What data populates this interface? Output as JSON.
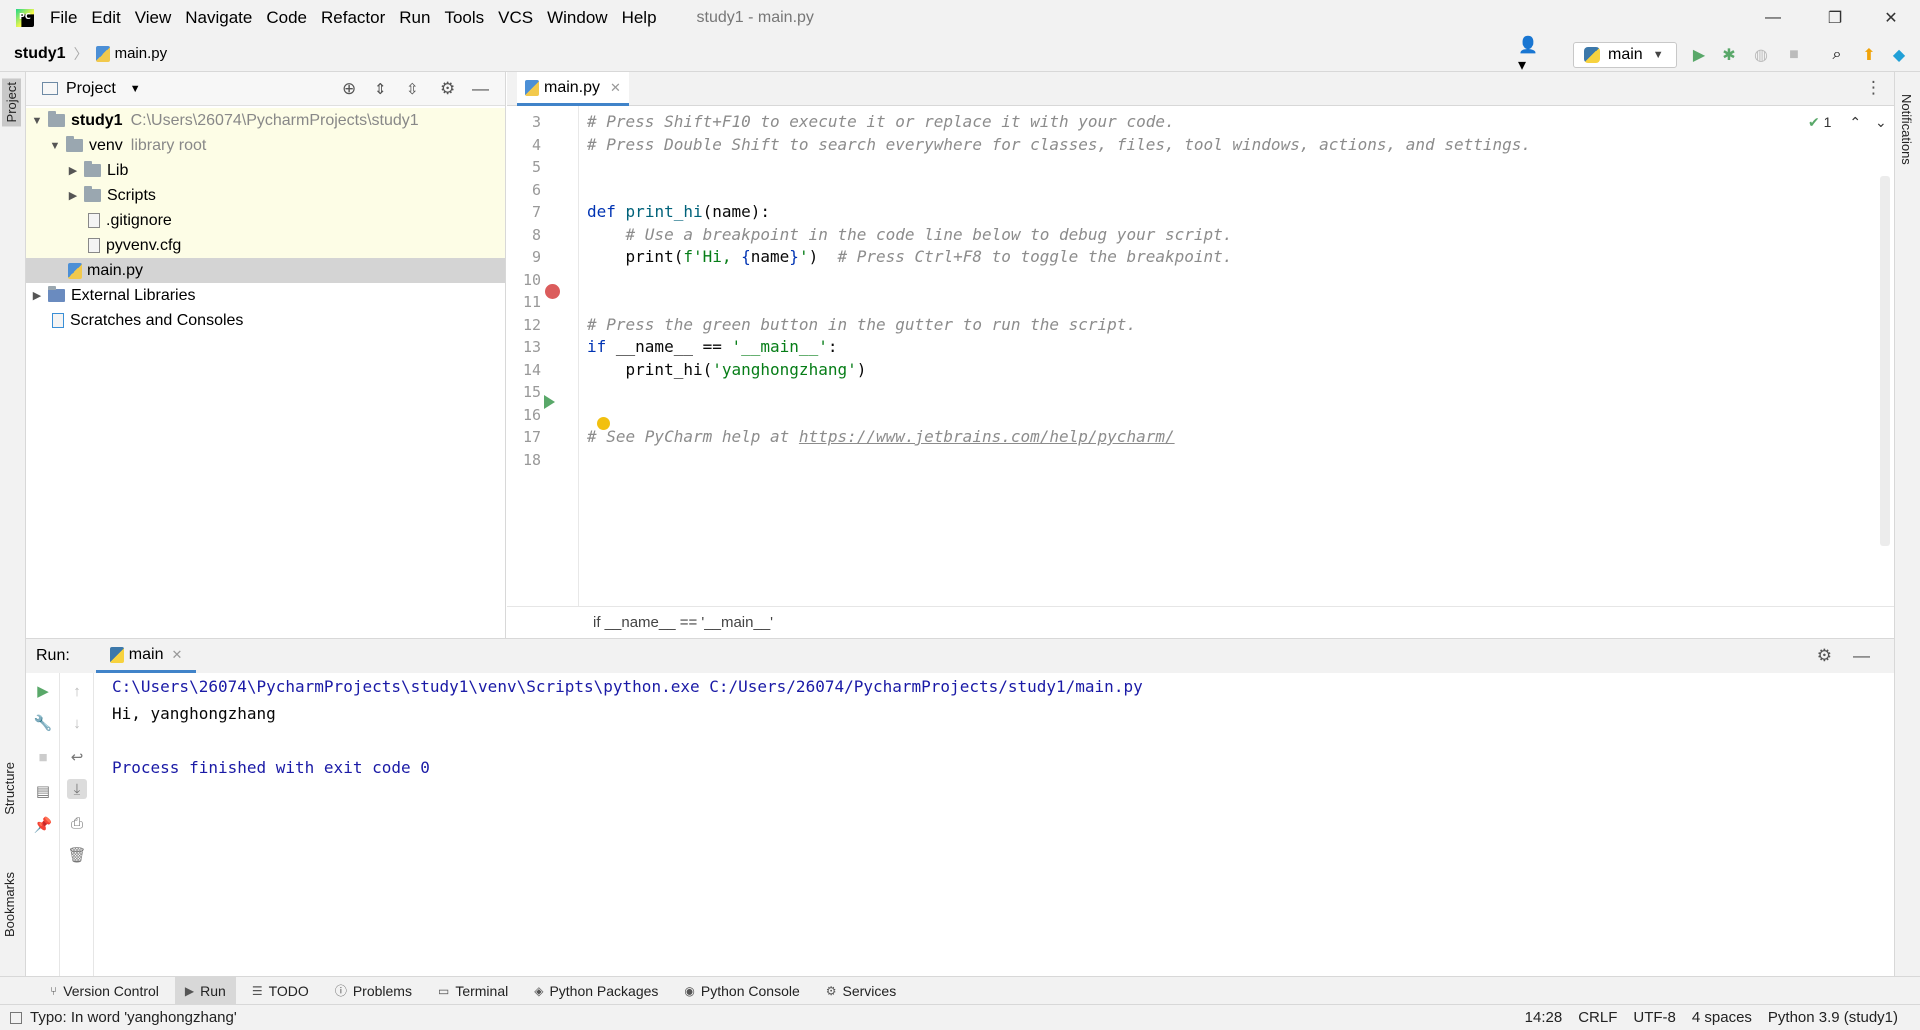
{
  "menu": [
    "File",
    "Edit",
    "View",
    "Navigate",
    "Code",
    "Refactor",
    "Run",
    "Tools",
    "VCS",
    "Window",
    "Help"
  ],
  "window_title": "study1 - main.py",
  "navbar": {
    "root": "study1",
    "file": "main.py"
  },
  "run_config": "main",
  "left_tabs": {
    "project": "Project",
    "structure": "Structure",
    "bookmarks": "Bookmarks"
  },
  "right_tabs": {
    "notifications": "Notifications"
  },
  "project": {
    "header": "Project",
    "tree": [
      {
        "label": "study1",
        "hint": "C:\\Users\\26074\\PycharmProjects\\study1",
        "level": 0,
        "arrow": "▼",
        "icon": "folder"
      },
      {
        "label": "venv",
        "hint": "library root",
        "level": 1,
        "arrow": "▼",
        "icon": "folder"
      },
      {
        "label": "Lib",
        "hint": "",
        "level": 2,
        "arrow": "▶",
        "icon": "folder"
      },
      {
        "label": "Scripts",
        "hint": "",
        "level": 2,
        "arrow": "▶",
        "icon": "folder"
      },
      {
        "label": ".gitignore",
        "hint": "",
        "level": 2,
        "arrow": "",
        "icon": "doc"
      },
      {
        "label": "pyvenv.cfg",
        "hint": "",
        "level": 2,
        "arrow": "",
        "icon": "doc"
      },
      {
        "label": "main.py",
        "hint": "",
        "level": 1,
        "arrow": "",
        "icon": "py"
      },
      {
        "label": "External Libraries",
        "hint": "",
        "level": 0,
        "arrow": "▶",
        "icon": "lib"
      },
      {
        "label": "Scratches and Consoles",
        "hint": "",
        "level": 0,
        "arrow": "",
        "icon": "scratch"
      }
    ]
  },
  "editor": {
    "tab": "main.py",
    "inspections": "1",
    "lines": [
      {
        "n": "3",
        "html": "<span class='cm'># Press Shift+F10 to execute it or replace it with your code.</span>"
      },
      {
        "n": "4",
        "html": "<span class='cm'># Press Double Shift to search everywhere for classes, files, tool windows, actions, and settings.</span>"
      },
      {
        "n": "5",
        "html": ""
      },
      {
        "n": "6",
        "html": ""
      },
      {
        "n": "7",
        "html": "<span class='kw'>def</span> <span class='fn'>print_hi</span>(name):"
      },
      {
        "n": "8",
        "html": "    <span class='cm'># Use a breakpoint in the code line below to debug your script.</span>"
      },
      {
        "n": "9",
        "html": "    print(<span class='str'>f'Hi, </span><span class='kw'>{</span>name<span class='kw'>}</span><span class='str'>'</span>)  <span class='cm'># Press Ctrl+F8 to toggle the breakpoint.</span>"
      },
      {
        "n": "10",
        "html": ""
      },
      {
        "n": "11",
        "html": ""
      },
      {
        "n": "12",
        "html": "<span class='cm'># Press the green button in the gutter to run the script.</span>"
      },
      {
        "n": "13",
        "html": "<span class='kw'>if</span> __name__ == <span class='str'>'__main__'</span>:"
      },
      {
        "n": "14",
        "html": "    print_hi(<span class='str'>'yanghongzhang'</span>)"
      },
      {
        "n": "15",
        "html": ""
      },
      {
        "n": "16",
        "html": ""
      },
      {
        "n": "17",
        "html": "<span class='cm'># See PyCharm help at </span><span class='url'>https://www.jetbrains.com/help/pycharm/</span>"
      },
      {
        "n": "18",
        "html": ""
      }
    ],
    "breadcrumb": "if __name__ == '__main__'"
  },
  "run": {
    "label": "Run:",
    "tab": "main",
    "output": [
      "C:\\Users\\26074\\PycharmProjects\\study1\\venv\\Scripts\\python.exe C:/Users/26074/PycharmProjects/study1/main.py",
      "Hi, yanghongzhang",
      "",
      "Process finished with exit code 0"
    ]
  },
  "bottom_tabs": [
    "Version Control",
    "Run",
    "TODO",
    "Problems",
    "Terminal",
    "Python Packages",
    "Python Console",
    "Services"
  ],
  "status": {
    "message": "Typo: In word 'yanghongzhang'",
    "position": "14:28",
    "line_sep": "CRLF",
    "encoding": "UTF-8",
    "indent": "4 spaces",
    "interpreter": "Python 3.9 (study1)"
  }
}
